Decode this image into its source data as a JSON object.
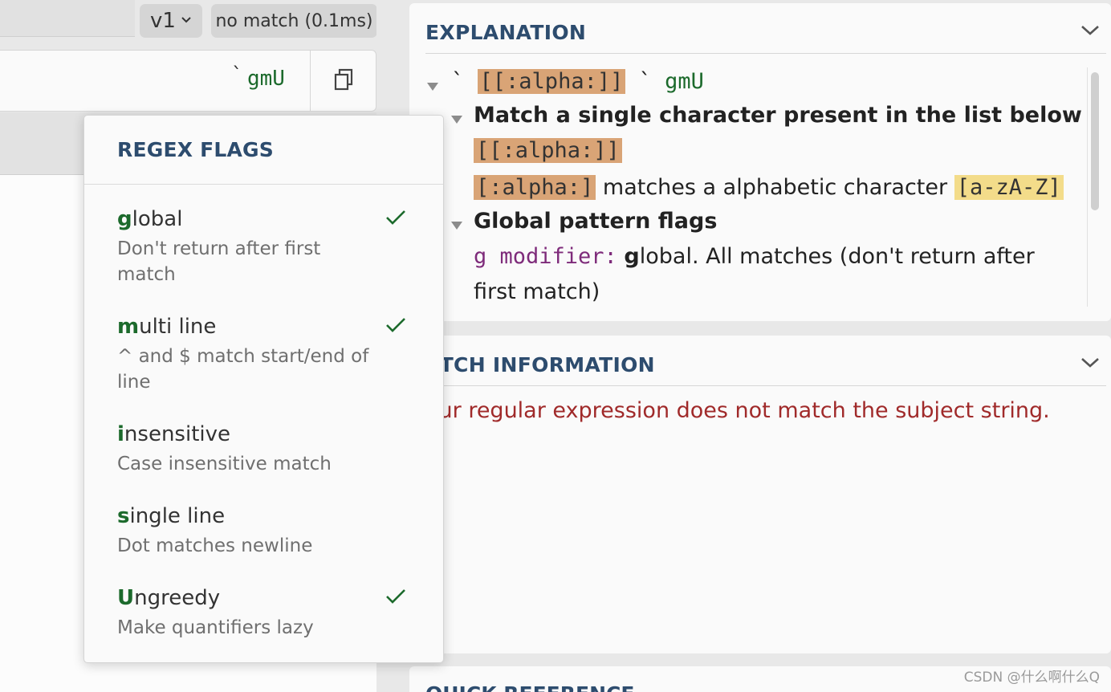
{
  "toolbar": {
    "version_label": "v1",
    "status_label": "no match (0.1ms)"
  },
  "regex": {
    "closing_delimiter": "`",
    "flags": "gmU"
  },
  "explanation": {
    "title": "EXPLANATION",
    "root_delim_open": "`",
    "root_pattern": "[[:alpha:]]",
    "root_delim_close": "`",
    "root_flags": "gmU",
    "node1_title": "Match a single character present in the list below",
    "node1_token": "[[:alpha:]]",
    "node1_class_token": "[:alpha:]",
    "node1_class_text": "matches a alphabetic character",
    "node1_class_range": "[a-zA-Z]",
    "node2_title": "Global pattern flags",
    "node2_modifier": "g modifier:",
    "node2_key": "g",
    "node2_text_line1": "lobal. All matches (don't return after",
    "node2_text_line2": "first match)"
  },
  "match_info": {
    "title": "ATCH INFORMATION",
    "message": "our regular expression does not match the subject string."
  },
  "quick_reference": {
    "title": "QUICK REFERENCE"
  },
  "flags_popover": {
    "title": "REGEX FLAGS",
    "items": [
      {
        "key": "g",
        "rest": "lobal",
        "desc": "Don't return after first match",
        "checked": true
      },
      {
        "key": "m",
        "rest": "ulti line",
        "desc": "^ and $ match start/end of line",
        "checked": true
      },
      {
        "key": "i",
        "rest": "nsensitive",
        "desc": "Case insensitive match",
        "checked": false
      },
      {
        "key": "s",
        "rest": "ingle line",
        "desc": "Dot matches newline",
        "checked": false
      },
      {
        "key": "U",
        "rest": "ngreedy",
        "desc": "Make quantifiers lazy",
        "checked": true
      }
    ]
  },
  "watermark": "CSDN @什么啊什么Q",
  "colors": {
    "accent_title": "#2d4c6e",
    "flag_green": "#1c6a2c",
    "error_red": "#a02a2a",
    "token_orange": "#d9a476",
    "token_yellow": "#f3dc8a",
    "modifier_purple": "#7e2b7a"
  },
  "icons": [
    "chevron-down-icon",
    "copy-icon",
    "check-icon",
    "disclosure-triangle-icon"
  ]
}
